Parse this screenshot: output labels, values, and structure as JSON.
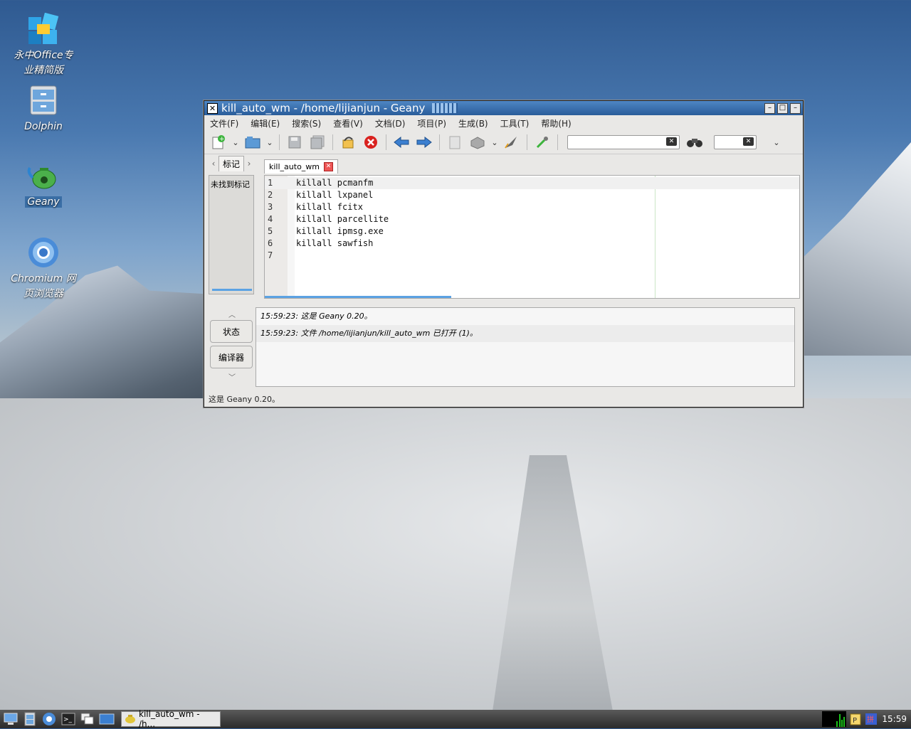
{
  "desktop": {
    "icons": [
      {
        "label_line1": "永中Office专",
        "label_line2": "业精简版"
      },
      {
        "label_line1": "Dolphin",
        "label_line2": ""
      },
      {
        "label_line1": "Geany",
        "label_line2": ""
      },
      {
        "label_line1": "Chromium 网",
        "label_line2": "页浏览器"
      }
    ]
  },
  "window": {
    "title": "kill_auto_wm - /home/lijianjun - Geany",
    "menu": [
      "文件(F)",
      "编辑(E)",
      "搜索(S)",
      "查看(V)",
      "文档(D)",
      "项目(P)",
      "生成(B)",
      "工具(T)",
      "帮助(H)"
    ],
    "search_value": "",
    "goto_value": "",
    "sidebar": {
      "tab_label": "标记",
      "empty_text": "未找到标记"
    },
    "editor": {
      "tab_label": "kill_auto_wm",
      "lines": [
        {
          "num": "1",
          "code": "killall pcmanfm"
        },
        {
          "num": "2",
          "code": "killall lxpanel"
        },
        {
          "num": "3",
          "code": "killall fcitx"
        },
        {
          "num": "4",
          "code": "killall parcellite"
        },
        {
          "num": "5",
          "code": "killall ipmsg.exe"
        },
        {
          "num": "6",
          "code": "killall sawfish"
        },
        {
          "num": "7",
          "code": ""
        }
      ]
    },
    "messages": {
      "tabs": [
        "状态",
        "编译器"
      ],
      "items": [
        "15:59:23: 这是 Geany 0.20。",
        "15:59:23: 文件 /home/lijianjun/kill_auto_wm 已打开 (1)。"
      ]
    },
    "status": "这是 Geany 0.20。"
  },
  "taskbar": {
    "task_label": "kill_auto_wm - /h...",
    "clock": "15:59"
  }
}
